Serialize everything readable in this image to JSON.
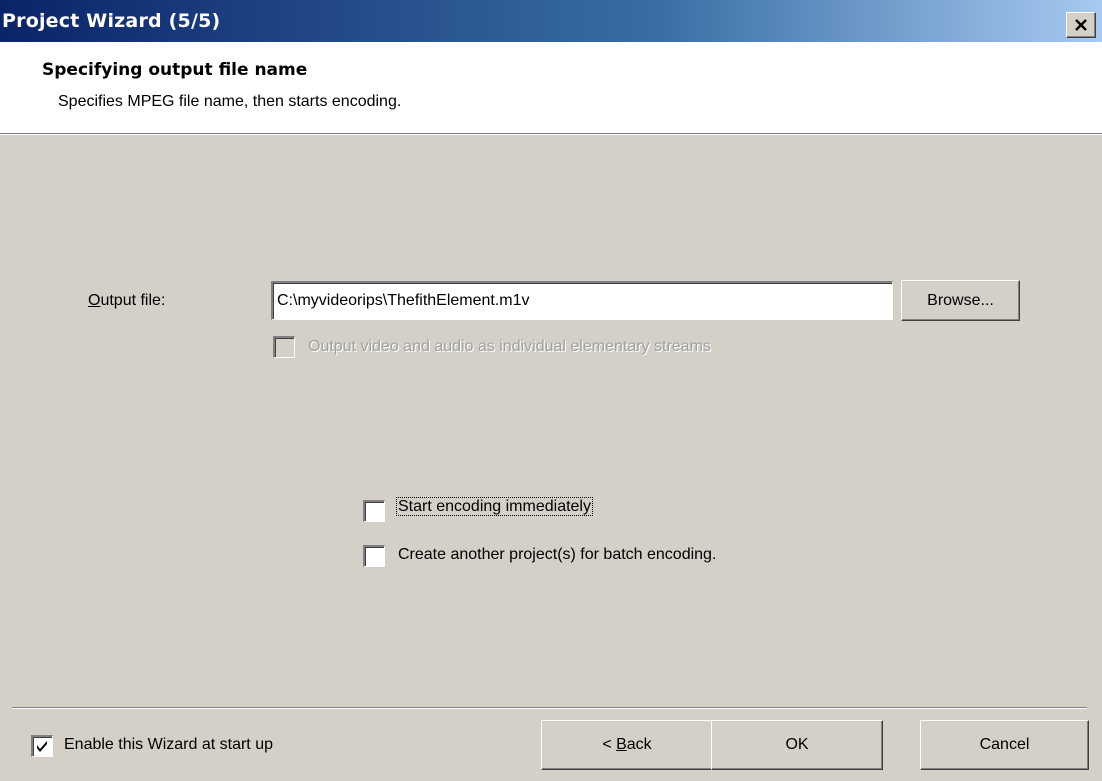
{
  "window": {
    "title": "Project Wizard (5/5)"
  },
  "header": {
    "title": "Specifying output file name",
    "subtitle": "Specifies MPEG file name, then starts encoding."
  },
  "output": {
    "label_accel": "O",
    "label_rest": "utput file:",
    "value": "C:\\myvideorips\\ThefithElement.m1v",
    "browse_label": "Browse...",
    "elementary_label": "Output video and audio as individual elementary streams",
    "elementary_checked": false,
    "elementary_enabled": false
  },
  "options": {
    "start_encoding_label": "Start encoding immediately",
    "start_encoding_checked": false,
    "batch_label": "Create another project(s) for batch encoding.",
    "batch_checked": false
  },
  "footer": {
    "enable_wizard_label": "Enable this Wizard at start up",
    "enable_wizard_checked": true,
    "back_prefix": "< ",
    "back_accel": "B",
    "back_rest": "ack",
    "ok_label": "OK",
    "cancel_label": "Cancel"
  },
  "icons": {
    "close": "close-icon",
    "check": "checkmark-icon"
  },
  "colors": {
    "title_gradient_start": "#0a246a",
    "title_gradient_end": "#a6caf0",
    "dialog_face": "#d4d0c8",
    "header_bg": "#ffffff"
  }
}
